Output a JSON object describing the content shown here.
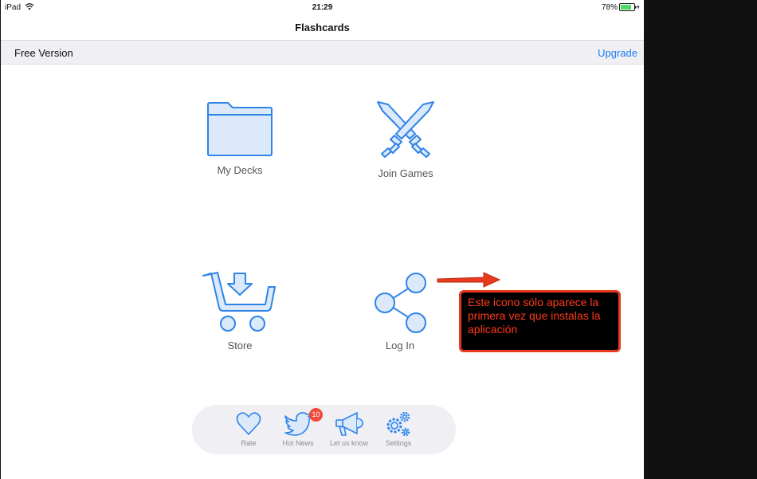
{
  "status_bar": {
    "device": "iPad",
    "time": "21:29",
    "battery": "78%"
  },
  "nav": {
    "title": "Flashcards"
  },
  "banner": {
    "label": "Free Version",
    "upgrade": "Upgrade"
  },
  "tiles": [
    {
      "label": "My Decks",
      "icon": "folder-icon"
    },
    {
      "label": "Join Games",
      "icon": "crossed-swords-icon"
    },
    {
      "label": "Store",
      "icon": "shopping-cart-download-icon"
    },
    {
      "label": "Log In",
      "icon": "share-icon"
    }
  ],
  "annotation": {
    "text": "Este icono sólo aparece la primera vez que instalas la aplicación",
    "color": "#ff3b1a"
  },
  "toolbar": {
    "items": [
      {
        "label": "Rate",
        "icon": "heart-icon"
      },
      {
        "label": "Hot News",
        "icon": "twitter-bird-icon"
      },
      {
        "label": "Let us know",
        "icon": "megaphone-icon"
      },
      {
        "label": "Settings",
        "icon": "gears-icon"
      }
    ],
    "news_badge": "10"
  },
  "colors": {
    "accent": "#1a7ef0",
    "icon_stroke": "#2f84e8",
    "icon_fill": "#dbe9fb",
    "badge": "#f04a3a"
  }
}
